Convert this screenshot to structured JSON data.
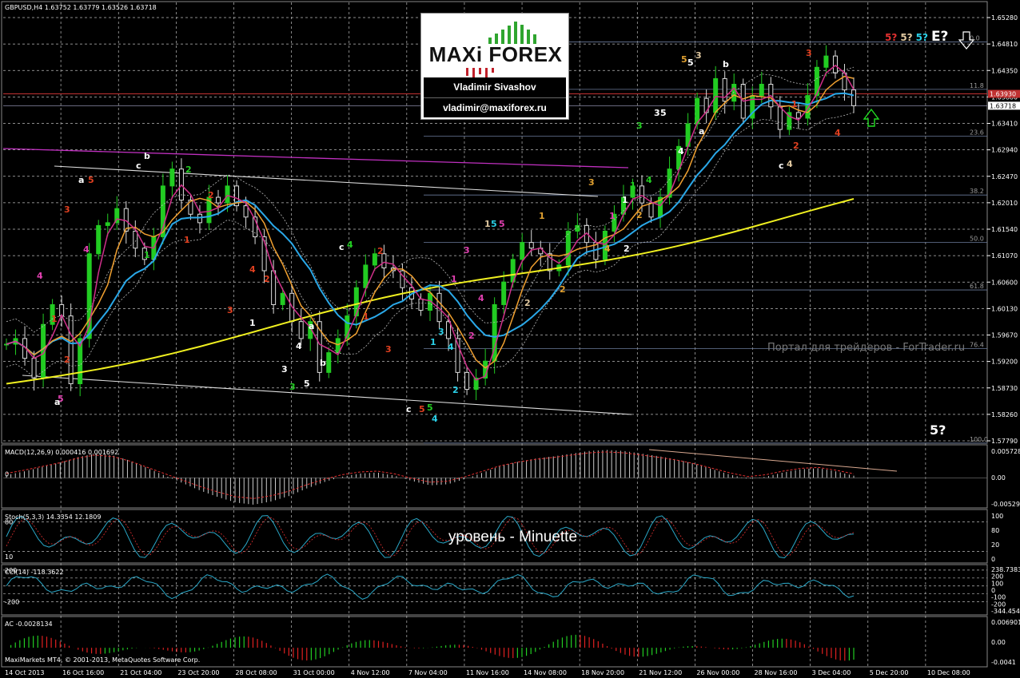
{
  "header": {
    "main": "GBPUSD,H4  1.63752 1.63779 1.63526 1.63718",
    "macd": "MACD(12,26,9) 0.000416 0.001692",
    "stoch": "Stoch(5,3,3) 14.3354 12.1809",
    "cci": "CCI(14) -118.3622",
    "ac": "AC -0.0028134",
    "copyright": "MaxiMarkets MT4, © 2001-2013, MetaQuotes Software Corp."
  },
  "logo": {
    "brand_left": "MAXi",
    "brand_right": "FOREX",
    "name": "Vladimir Sivashov",
    "email": "vladimir@maxiforex.ru"
  },
  "watermark": "Портал для трейдеров - ForTrader.ru",
  "level_note": "уровень - Minuette",
  "top_labels": [
    {
      "text": "5?",
      "color": "#e03030"
    },
    {
      "text": "5?",
      "color": "#e0c8a0"
    },
    {
      "text": "5?",
      "color": "#2ad0e8"
    },
    {
      "text": "E?",
      "color": "#ffffff"
    }
  ],
  "bottom_right_label": "5?",
  "price_axis": [
    "1.65280",
    "1.64810",
    "1.64350",
    "1.63880",
    "1.63410",
    "1.62940",
    "1.62470",
    "1.62010",
    "1.61540",
    "1.61070",
    "1.60600",
    "1.60130",
    "1.59670",
    "1.59200",
    "1.58730",
    "1.58260",
    "1.57790"
  ],
  "price_tags": {
    "red": "1.63930",
    "white": "1.63718"
  },
  "macd_axis": [
    "0.005728",
    "0.00",
    "-0.005299"
  ],
  "macd_zero_label": "0",
  "stoch_axis": [
    "100",
    "80",
    "20",
    "0"
  ],
  "stoch_left": [
    "80",
    "10"
  ],
  "cci_axis": [
    "238.7383",
    "200",
    "100",
    "0",
    "-100",
    "-200",
    "-344.4546"
  ],
  "cci_left": [
    "200",
    "-200"
  ],
  "ac_axis": [
    "0.006901",
    "0.00",
    "-0.0041"
  ],
  "time_axis": [
    "14 Oct 2013",
    "16 Oct 16:00",
    "21 Oct 04:00",
    "23 Oct 20:00",
    "28 Oct 08:00",
    "31 Oct 00:00",
    "4 Nov 12:00",
    "7 Nov 04:00",
    "11 Nov 16:00",
    "14 Nov 08:00",
    "18 Nov 20:00",
    "21 Nov 12:00",
    "26 Nov 00:00",
    "28 Nov 16:00",
    "3 Dec 04:00",
    "5 Dec 20:00",
    "10 Dec 08:00"
  ],
  "fib_levels": [
    {
      "label": "0.0",
      "price": 1.6485
    },
    {
      "label": "11.8",
      "price": 1.6401
    },
    {
      "label": "23.6",
      "price": 1.6318
    },
    {
      "label": "38.2",
      "price": 1.6214
    },
    {
      "label": "50.0",
      "price": 1.613
    },
    {
      "label": "61.8",
      "price": 1.6046
    },
    {
      "label": "76.4",
      "price": 1.5942
    },
    {
      "label": "100.0",
      "price": 1.5775
    }
  ],
  "chart_data": {
    "type": "line",
    "symbol": "GBPUSD",
    "timeframe": "H4",
    "ylim": [
      1.5779,
      1.6528
    ],
    "close": [
      1.595,
      1.596,
      1.5925,
      1.589,
      1.5985,
      1.602,
      1.6,
      1.588,
      1.596,
      1.611,
      1.616,
      1.6165,
      1.619,
      1.615,
      1.612,
      1.61,
      1.614,
      1.623,
      1.626,
      1.6205,
      1.618,
      1.6165,
      1.621,
      1.62,
      1.623,
      1.6195,
      1.6175,
      1.614,
      1.608,
      1.602,
      1.604,
      1.599,
      1.596,
      1.599,
      1.59,
      1.5935,
      1.596,
      1.6,
      1.605,
      1.609,
      1.611,
      1.6085,
      1.608,
      1.605,
      1.603,
      1.601,
      1.604,
      1.599,
      1.596,
      1.59,
      1.587,
      1.589,
      1.592,
      1.602,
      1.606,
      1.61,
      1.613,
      1.612,
      1.611,
      1.608,
      1.609,
      1.615,
      1.616,
      1.613,
      1.61,
      1.615,
      1.618,
      1.621,
      1.623,
      1.62,
      1.6175,
      1.621,
      1.626,
      1.63,
      1.634,
      1.6385,
      1.636,
      1.642,
      1.638,
      1.641,
      1.635,
      1.639,
      1.641,
      1.637,
      1.633,
      1.636,
      1.635,
      1.639,
      1.644,
      1.646,
      1.643,
      1.64,
      1.6372
    ],
    "series": [
      {
        "name": "MA 200",
        "color": "#f0f020"
      },
      {
        "name": "MA",
        "color": "#2aa8e8"
      }
    ],
    "macd": [
      0.0005,
      0.0012,
      0.002,
      0.0028,
      0.0038,
      0.0045,
      0.0042,
      0.0032,
      0.0018,
      0.0004,
      -0.001,
      -0.0024,
      -0.0036,
      -0.0046,
      -0.005,
      -0.0044,
      -0.0034,
      -0.002,
      -0.0008,
      0.0002,
      0.0008,
      0.001,
      0.0004,
      -0.0006,
      -0.0014,
      -0.0012,
      -0.0002,
      0.001,
      0.0022,
      0.003,
      0.0036,
      0.004,
      0.0045,
      0.005,
      0.0052,
      0.005,
      0.0045,
      0.004,
      0.0034,
      0.0026,
      0.0016,
      0.0006,
      -0.0002,
      0.0002,
      0.001,
      0.0016,
      0.0018,
      0.0012,
      0.0004
    ],
    "stoch_range": [
      0,
      100
    ],
    "cci_range": [
      -344.4546,
      238.7383
    ],
    "ac_range": [
      -0.0041,
      0.006901
    ]
  }
}
